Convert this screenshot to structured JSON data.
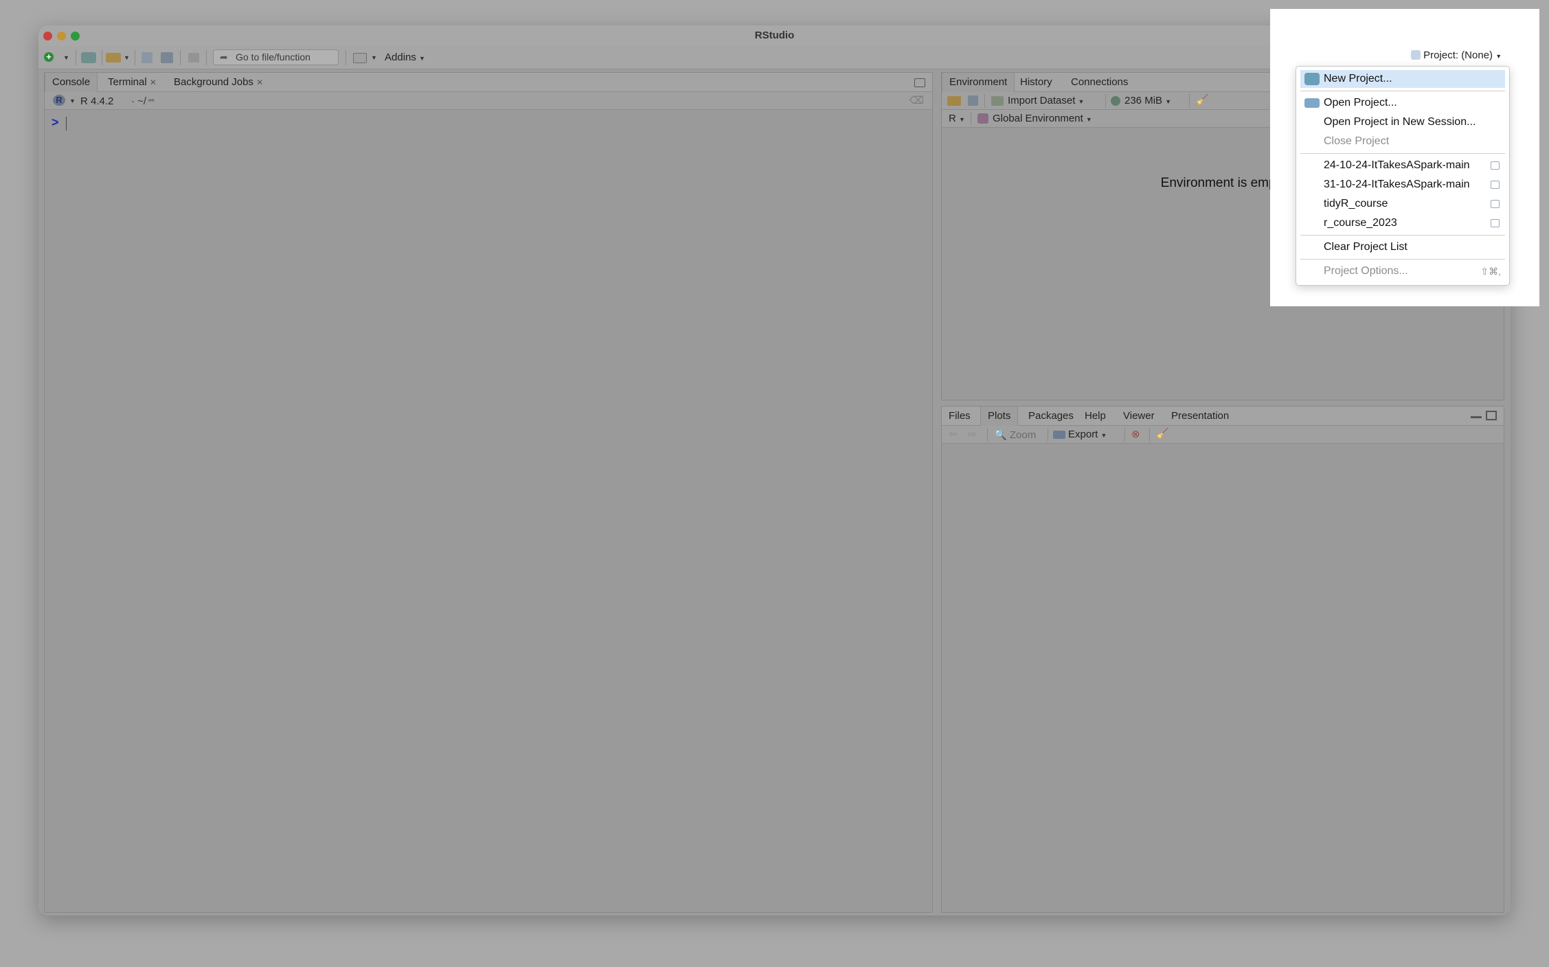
{
  "window": {
    "title": "RStudio"
  },
  "toolbar": {
    "goto_placeholder": "Go to file/function",
    "addins_label": "Addins",
    "project_label": "Project: (None)"
  },
  "console_pane": {
    "tabs": [
      "Console",
      "Terminal",
      "Background Jobs"
    ],
    "r_version": "R 4.4.2",
    "path": "· ~/",
    "prompt": ">"
  },
  "env_pane": {
    "tabs": [
      "Environment",
      "History",
      "Connections"
    ],
    "import_label": "Import Dataset",
    "memory_label": "236 MiB",
    "lang_label": "R",
    "scope_label": "Global Environment",
    "empty_message": "Environment is empty"
  },
  "files_pane": {
    "tabs": [
      "Files",
      "Plots",
      "Packages",
      "Help",
      "Viewer",
      "Presentation"
    ],
    "zoom_label": "Zoom",
    "export_label": "Export"
  },
  "project_menu": {
    "new_project": "New Project...",
    "open_project": "Open Project...",
    "open_new_session": "Open Project in New Session...",
    "close_project": "Close Project",
    "recent": [
      "24-10-24-ItTakesASpark-main",
      "31-10-24-ItTakesASpark-main",
      "tidyR_course",
      "r_course_2023"
    ],
    "clear_list": "Clear Project List",
    "options": "Project Options...",
    "options_shortcut": "⇧⌘,"
  },
  "colors": {
    "menu_highlight": "#d5e6f8",
    "prompt": "#1a2fb0",
    "close_light": "#e0443e",
    "min_light": "#dea123",
    "max_light": "#1aab29"
  }
}
